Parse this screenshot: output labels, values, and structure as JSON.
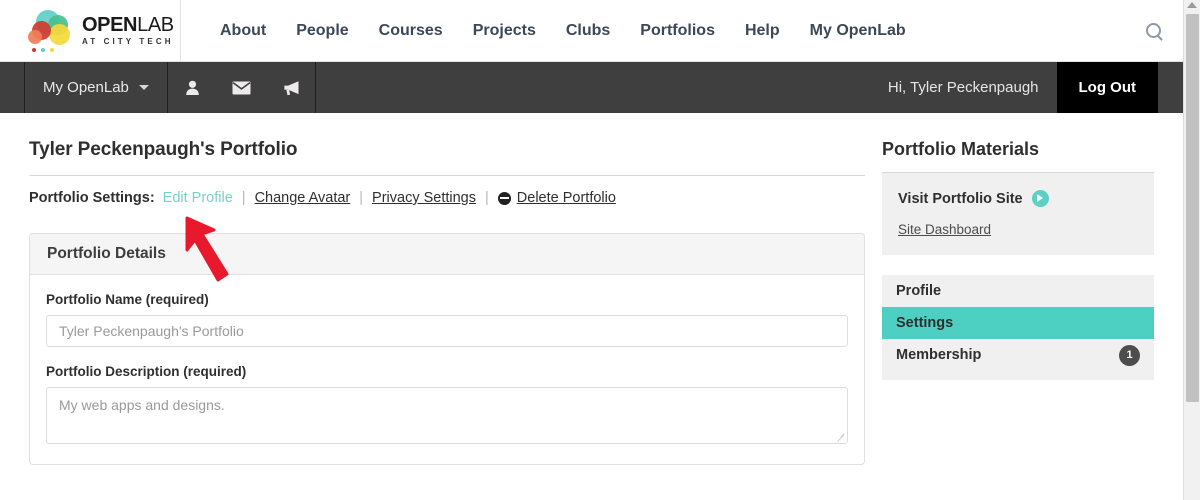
{
  "site": {
    "logo_name": "OPENLAB",
    "logo_open": "OPEN",
    "logo_lab": "LAB",
    "logo_tagline": "AT CITY TECH",
    "accent_teal": "#4dcfc1",
    "accent_light_teal": "#79cfca",
    "dark_bar": "#3f3f3f"
  },
  "nav": {
    "items": [
      {
        "label": "About"
      },
      {
        "label": "People"
      },
      {
        "label": "Courses"
      },
      {
        "label": "Projects"
      },
      {
        "label": "Clubs"
      },
      {
        "label": "Portfolios"
      },
      {
        "label": "Help"
      },
      {
        "label": "My OpenLab"
      }
    ],
    "search_icon": "search-icon"
  },
  "adminbar": {
    "menu_label": "My OpenLab",
    "icons": [
      {
        "name": "profile-icon"
      },
      {
        "name": "messages-icon"
      },
      {
        "name": "announcements-icon"
      }
    ],
    "greeting": "Hi, Tyler Peckenpaugh",
    "logout_label": "Log Out"
  },
  "main": {
    "page_title": "Tyler Peckenpaugh's Portfolio",
    "settings_label": "Portfolio Settings:",
    "links": {
      "edit_profile": "Edit Profile",
      "change_avatar": "Change Avatar",
      "privacy_settings": "Privacy Settings",
      "delete_portfolio": "Delete Portfolio"
    },
    "panel": {
      "heading": "Portfolio Details",
      "name_label": "Portfolio Name (required)",
      "name_value": "Tyler Peckenpaugh's Portfolio",
      "description_label": "Portfolio Description (required)",
      "description_value": "My web apps and designs."
    }
  },
  "sidebar": {
    "title": "Portfolio Materials",
    "visit_label": "Visit Portfolio Site",
    "dashboard_label": "Site Dashboard",
    "menu": [
      {
        "label": "Profile",
        "badge": "",
        "active": false
      },
      {
        "label": "Settings",
        "badge": "",
        "active": true
      },
      {
        "label": "Membership",
        "badge": "1",
        "active": false
      }
    ]
  },
  "annotation": {
    "cursor_color": "#e8192c"
  }
}
